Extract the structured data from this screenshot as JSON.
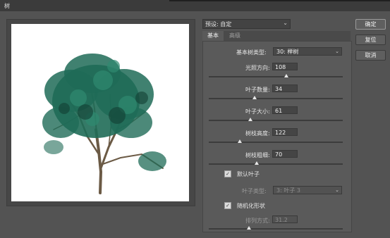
{
  "window": {
    "title": "树"
  },
  "preset": {
    "label": "预设: 自定"
  },
  "buttons": {
    "ok": "确定",
    "reset": "复位",
    "cancel": "取消"
  },
  "tabs": [
    {
      "label": "基本"
    },
    {
      "label": "高级"
    }
  ],
  "basic": {
    "tree_type_label": "基本树类型:",
    "tree_type_value": "30: 榉树",
    "light_direction": {
      "label": "光照方向:",
      "value": "108"
    },
    "leaves_amount": {
      "label": "叶子数量:",
      "value": "34"
    },
    "leaves_size": {
      "label": "叶子大小:",
      "value": "61"
    },
    "branch_height": {
      "label": "树枝高度:",
      "value": "122"
    },
    "branch_thickness": {
      "label": "树枝粗细:",
      "value": "70"
    },
    "default_leaves": {
      "label": "默认叶子",
      "checked": true
    },
    "leaves_type": {
      "label": "叶子类型:",
      "value": "3: 叶子 3"
    },
    "randomize": {
      "label": "随机化形状",
      "checked": true
    },
    "arrangement": {
      "label": "排列方式:",
      "value": "31.2"
    }
  },
  "sliders": {
    "light_direction": 0.58,
    "leaves_amount": 0.34,
    "leaves_size": 0.31,
    "branch_height": 0.23,
    "branch_thickness": 0.36,
    "arrangement": 0.3
  },
  "colors": {
    "foliage": "#1f6b57",
    "trunk": "#6b5a45",
    "panel": "#5a5a5a"
  }
}
